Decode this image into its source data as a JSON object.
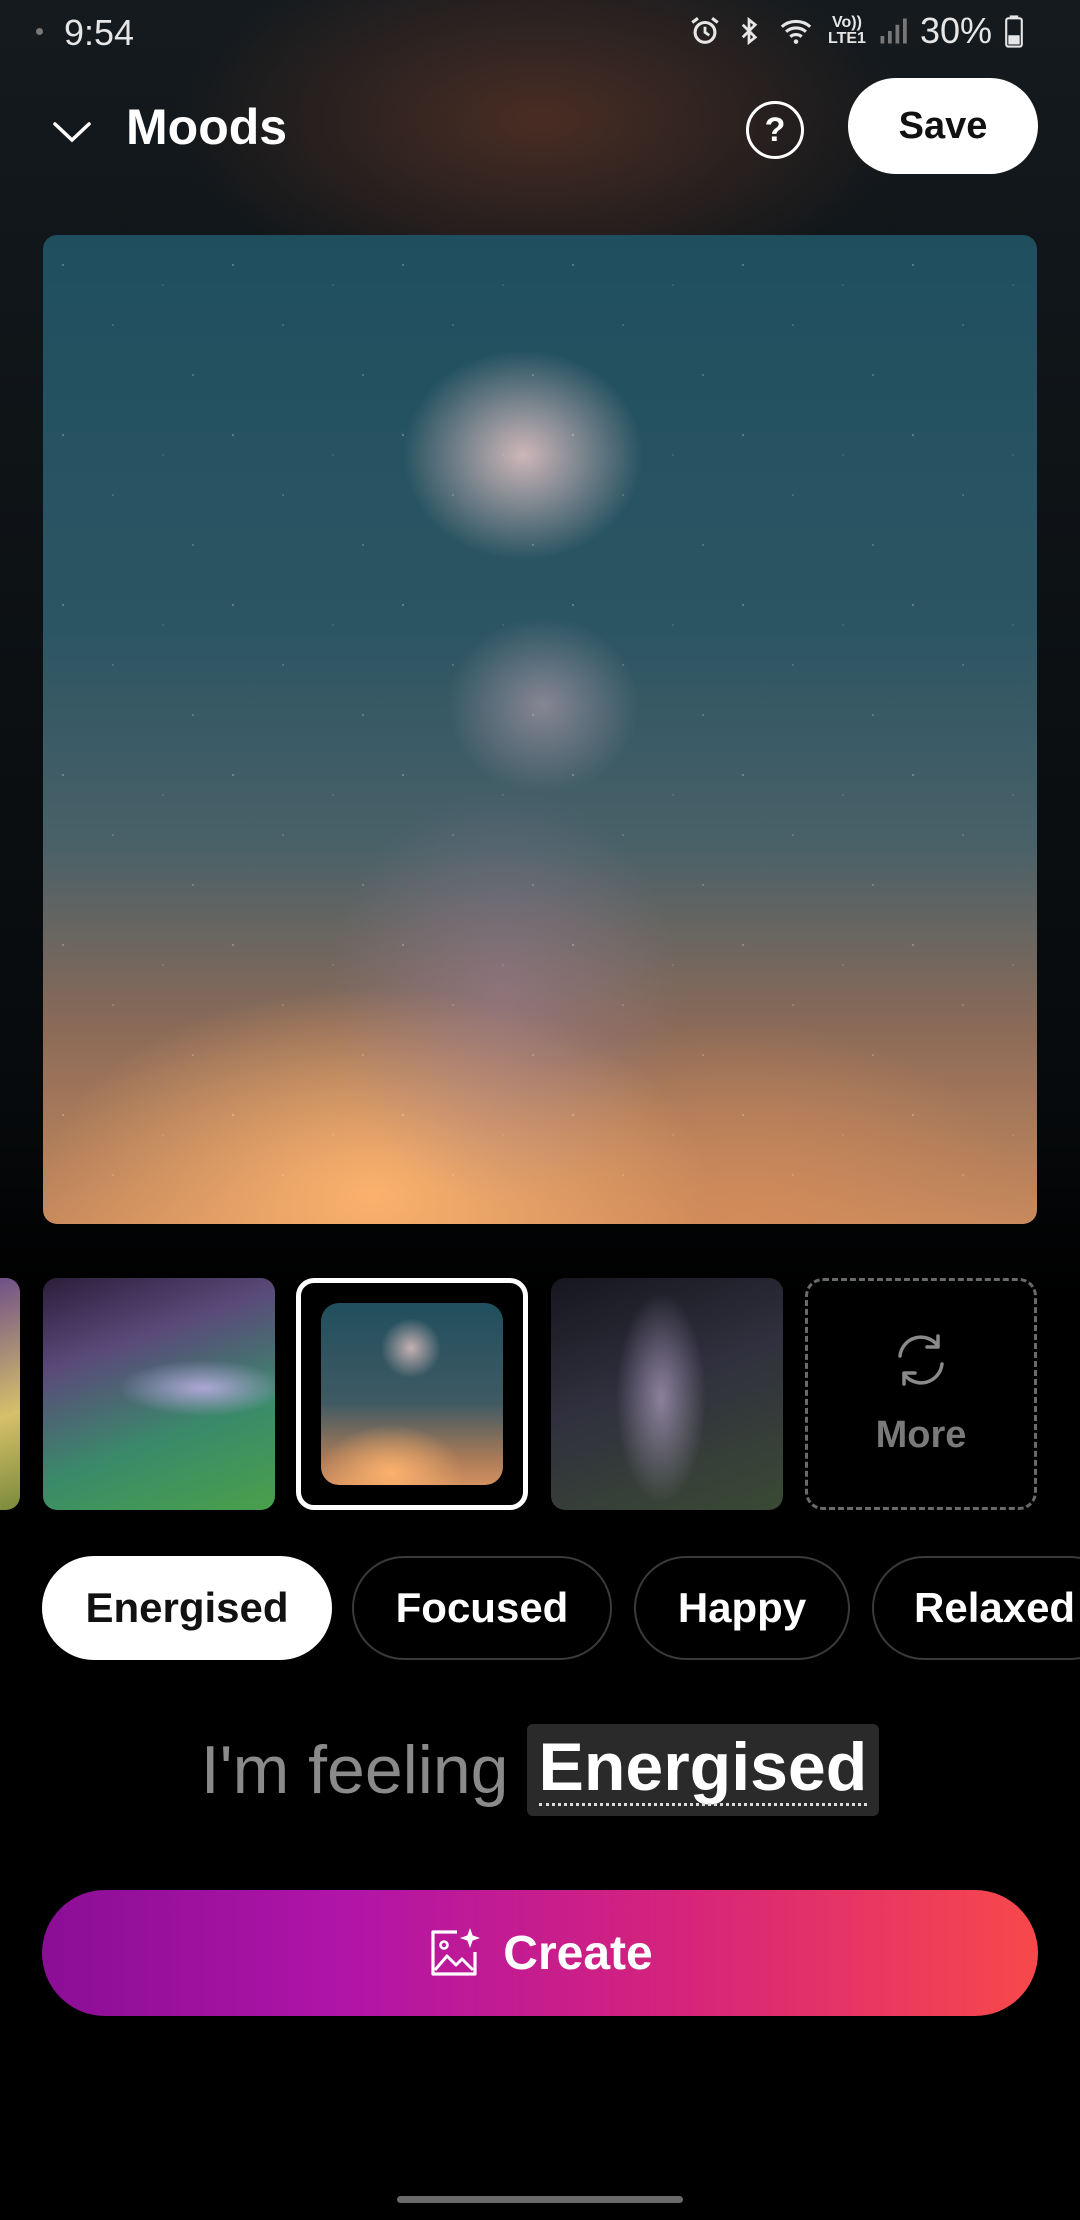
{
  "status_bar": {
    "time": "9:54",
    "network_badge_top": "Vo))",
    "network_badge_bottom": "LTE1",
    "battery_percent": "30%",
    "icons": [
      "alarm-icon",
      "bluetooth-icon",
      "wifi-icon",
      "signal-icon",
      "battery-icon"
    ]
  },
  "header": {
    "title": "Moods",
    "help_label": "?",
    "save_label": "Save"
  },
  "thumbnails": {
    "selected_index": 2,
    "more_label": "More"
  },
  "moods": {
    "chips": [
      "Energised",
      "Focused",
      "Happy",
      "Relaxed"
    ],
    "selected": "Energised"
  },
  "feeling": {
    "prefix": "I'm feeling",
    "mood": "Energised"
  },
  "create": {
    "label": "Create"
  },
  "colors": {
    "create_gradient_start": "#8a0e96",
    "create_gradient_end": "#f7494a",
    "selected_chip_bg": "#ffffff"
  }
}
